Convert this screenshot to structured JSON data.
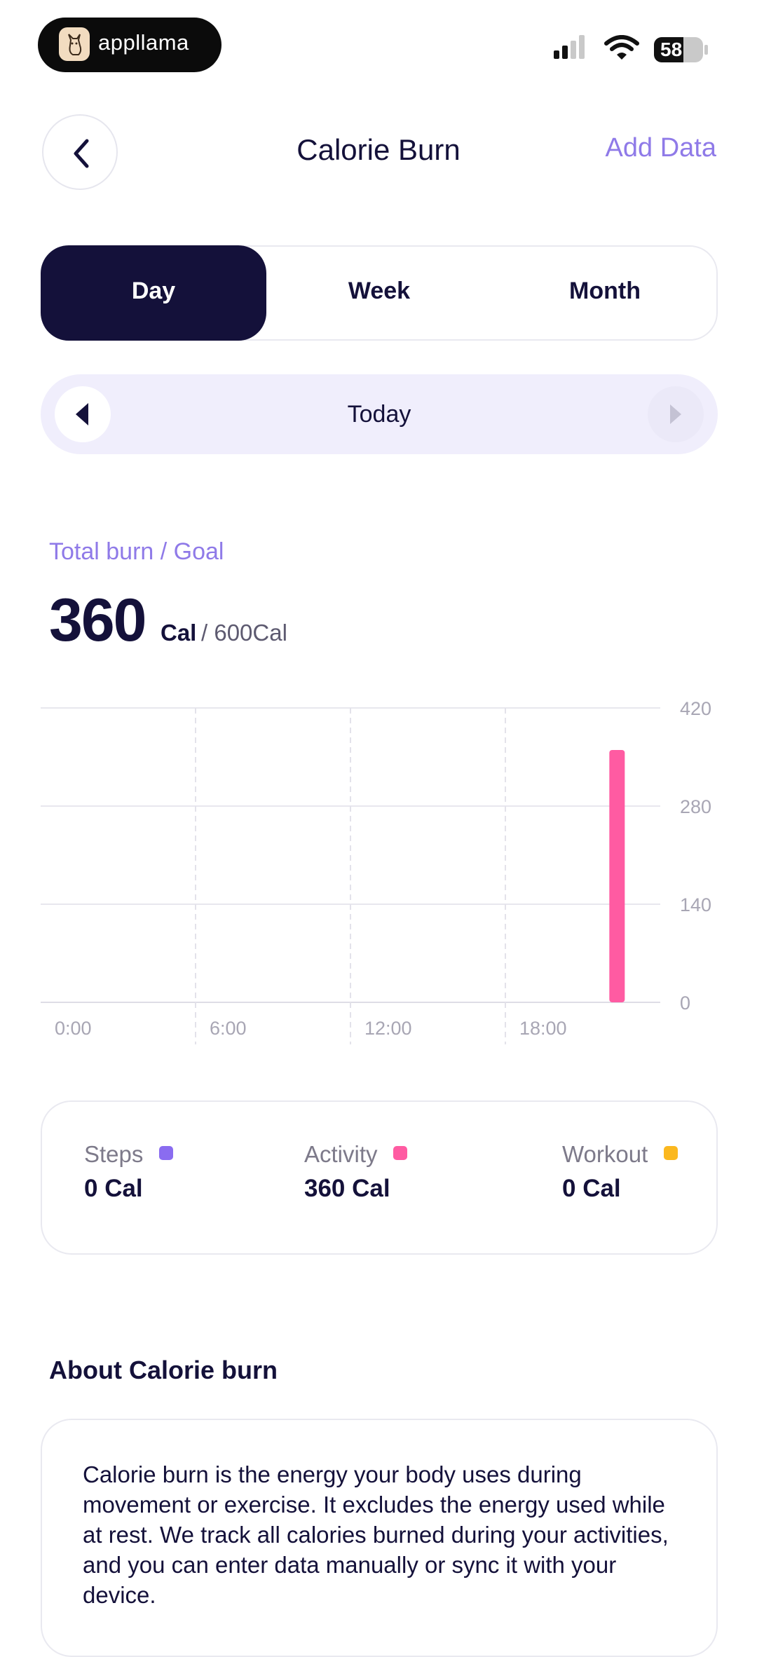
{
  "status_bar": {
    "brand": "appllama",
    "battery": "58"
  },
  "header": {
    "title": "Calorie Burn",
    "add_data": "Add Data"
  },
  "period_tabs": [
    "Day",
    "Week",
    "Month"
  ],
  "period_selected": "Day",
  "date_nav": {
    "label": "Today"
  },
  "summary": {
    "label": "Total burn / Goal",
    "value": "360",
    "unit": "Cal",
    "goal": "/ 600Cal"
  },
  "chart_data": {
    "type": "bar",
    "x_ticks": [
      "0:00",
      "6:00",
      "12:00",
      "18:00"
    ],
    "y_ticks": [
      "420",
      "280",
      "140",
      "0"
    ],
    "ylim": [
      0,
      420
    ],
    "xlim": [
      0,
      24
    ],
    "bars": [
      {
        "x": 22,
        "value": 360,
        "series": "Activity"
      }
    ],
    "grid": true,
    "colors": {
      "Activity": "#ff5ba2"
    }
  },
  "legend": [
    {
      "name": "Steps",
      "value": "0 Cal",
      "color": "#8a6cf0"
    },
    {
      "name": "Activity",
      "value": "360 Cal",
      "color": "#ff5ba2"
    },
    {
      "name": "Workout",
      "value": "0 Cal",
      "color": "#fbb81f"
    }
  ],
  "about": {
    "title": "About Calorie burn",
    "text": "Calorie burn is the energy your body uses during movement or exercise. It excludes the energy used while at rest. We track all calories burned during your activities, and you can enter data manually or sync it with your device."
  },
  "icons": {
    "back": "chevron-left-icon",
    "prev": "triangle-left-icon",
    "next": "triangle-right-icon"
  }
}
